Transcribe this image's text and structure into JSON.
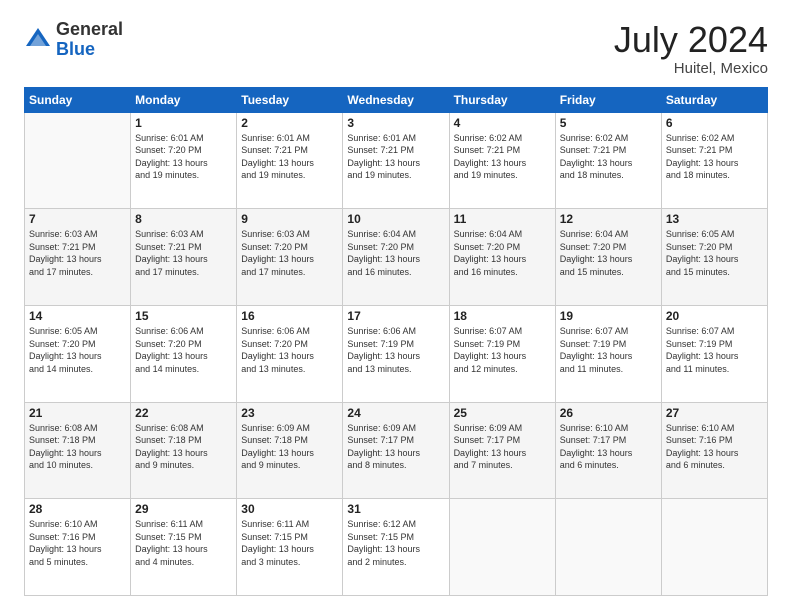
{
  "header": {
    "logo_general": "General",
    "logo_blue": "Blue",
    "month_title": "July 2024",
    "location": "Huitel, Mexico"
  },
  "days_of_week": [
    "Sunday",
    "Monday",
    "Tuesday",
    "Wednesday",
    "Thursday",
    "Friday",
    "Saturday"
  ],
  "weeks": [
    [
      {
        "day": "",
        "info": ""
      },
      {
        "day": "1",
        "info": "Sunrise: 6:01 AM\nSunset: 7:20 PM\nDaylight: 13 hours\nand 19 minutes."
      },
      {
        "day": "2",
        "info": "Sunrise: 6:01 AM\nSunset: 7:21 PM\nDaylight: 13 hours\nand 19 minutes."
      },
      {
        "day": "3",
        "info": "Sunrise: 6:01 AM\nSunset: 7:21 PM\nDaylight: 13 hours\nand 19 minutes."
      },
      {
        "day": "4",
        "info": "Sunrise: 6:02 AM\nSunset: 7:21 PM\nDaylight: 13 hours\nand 19 minutes."
      },
      {
        "day": "5",
        "info": "Sunrise: 6:02 AM\nSunset: 7:21 PM\nDaylight: 13 hours\nand 18 minutes."
      },
      {
        "day": "6",
        "info": "Sunrise: 6:02 AM\nSunset: 7:21 PM\nDaylight: 13 hours\nand 18 minutes."
      }
    ],
    [
      {
        "day": "7",
        "info": "Sunrise: 6:03 AM\nSunset: 7:21 PM\nDaylight: 13 hours\nand 17 minutes."
      },
      {
        "day": "8",
        "info": "Sunrise: 6:03 AM\nSunset: 7:21 PM\nDaylight: 13 hours\nand 17 minutes."
      },
      {
        "day": "9",
        "info": "Sunrise: 6:03 AM\nSunset: 7:20 PM\nDaylight: 13 hours\nand 17 minutes."
      },
      {
        "day": "10",
        "info": "Sunrise: 6:04 AM\nSunset: 7:20 PM\nDaylight: 13 hours\nand 16 minutes."
      },
      {
        "day": "11",
        "info": "Sunrise: 6:04 AM\nSunset: 7:20 PM\nDaylight: 13 hours\nand 16 minutes."
      },
      {
        "day": "12",
        "info": "Sunrise: 6:04 AM\nSunset: 7:20 PM\nDaylight: 13 hours\nand 15 minutes."
      },
      {
        "day": "13",
        "info": "Sunrise: 6:05 AM\nSunset: 7:20 PM\nDaylight: 13 hours\nand 15 minutes."
      }
    ],
    [
      {
        "day": "14",
        "info": "Sunrise: 6:05 AM\nSunset: 7:20 PM\nDaylight: 13 hours\nand 14 minutes."
      },
      {
        "day": "15",
        "info": "Sunrise: 6:06 AM\nSunset: 7:20 PM\nDaylight: 13 hours\nand 14 minutes."
      },
      {
        "day": "16",
        "info": "Sunrise: 6:06 AM\nSunset: 7:20 PM\nDaylight: 13 hours\nand 13 minutes."
      },
      {
        "day": "17",
        "info": "Sunrise: 6:06 AM\nSunset: 7:19 PM\nDaylight: 13 hours\nand 13 minutes."
      },
      {
        "day": "18",
        "info": "Sunrise: 6:07 AM\nSunset: 7:19 PM\nDaylight: 13 hours\nand 12 minutes."
      },
      {
        "day": "19",
        "info": "Sunrise: 6:07 AM\nSunset: 7:19 PM\nDaylight: 13 hours\nand 11 minutes."
      },
      {
        "day": "20",
        "info": "Sunrise: 6:07 AM\nSunset: 7:19 PM\nDaylight: 13 hours\nand 11 minutes."
      }
    ],
    [
      {
        "day": "21",
        "info": "Sunrise: 6:08 AM\nSunset: 7:18 PM\nDaylight: 13 hours\nand 10 minutes."
      },
      {
        "day": "22",
        "info": "Sunrise: 6:08 AM\nSunset: 7:18 PM\nDaylight: 13 hours\nand 9 minutes."
      },
      {
        "day": "23",
        "info": "Sunrise: 6:09 AM\nSunset: 7:18 PM\nDaylight: 13 hours\nand 9 minutes."
      },
      {
        "day": "24",
        "info": "Sunrise: 6:09 AM\nSunset: 7:17 PM\nDaylight: 13 hours\nand 8 minutes."
      },
      {
        "day": "25",
        "info": "Sunrise: 6:09 AM\nSunset: 7:17 PM\nDaylight: 13 hours\nand 7 minutes."
      },
      {
        "day": "26",
        "info": "Sunrise: 6:10 AM\nSunset: 7:17 PM\nDaylight: 13 hours\nand 6 minutes."
      },
      {
        "day": "27",
        "info": "Sunrise: 6:10 AM\nSunset: 7:16 PM\nDaylight: 13 hours\nand 6 minutes."
      }
    ],
    [
      {
        "day": "28",
        "info": "Sunrise: 6:10 AM\nSunset: 7:16 PM\nDaylight: 13 hours\nand 5 minutes."
      },
      {
        "day": "29",
        "info": "Sunrise: 6:11 AM\nSunset: 7:15 PM\nDaylight: 13 hours\nand 4 minutes."
      },
      {
        "day": "30",
        "info": "Sunrise: 6:11 AM\nSunset: 7:15 PM\nDaylight: 13 hours\nand 3 minutes."
      },
      {
        "day": "31",
        "info": "Sunrise: 6:12 AM\nSunset: 7:15 PM\nDaylight: 13 hours\nand 2 minutes."
      },
      {
        "day": "",
        "info": ""
      },
      {
        "day": "",
        "info": ""
      },
      {
        "day": "",
        "info": ""
      }
    ]
  ]
}
